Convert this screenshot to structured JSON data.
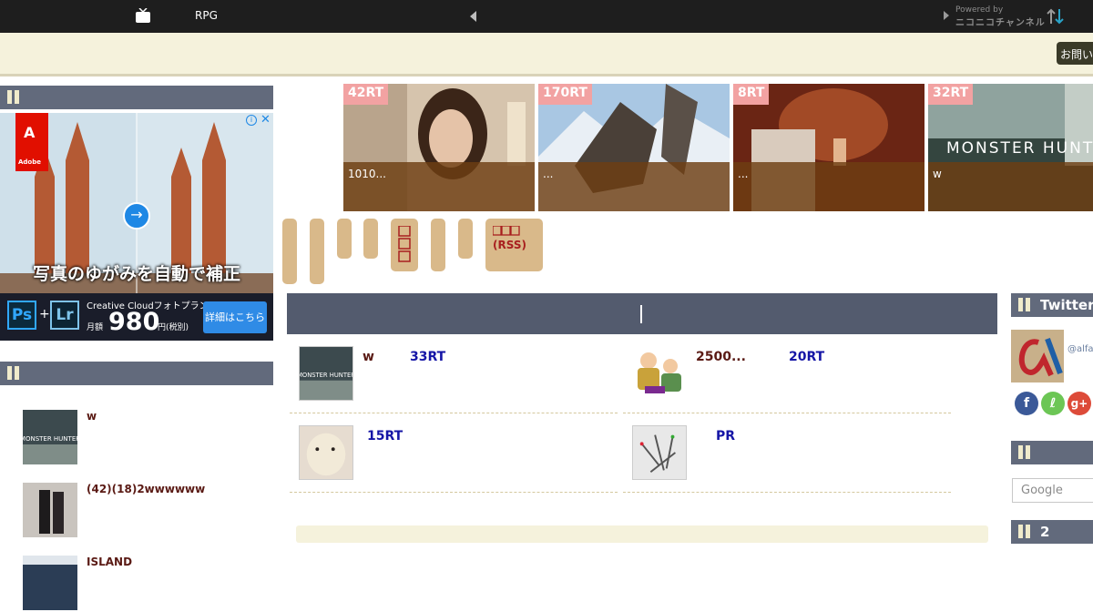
{
  "topbar": {
    "title": "RPG",
    "powered_by": "Powered by",
    "niconico": "ニコニコチャンネル"
  },
  "header": {
    "contact_label": "お問い"
  },
  "left_sidebar": {
    "ad": {
      "brand": "Adobe",
      "headline": "写真のゆがみを自動で補正",
      "ps": "Ps",
      "lr": "Lr",
      "plus": "+",
      "plan": "Creative Cloudフォトプラン",
      "price_label": "月額",
      "price": "980",
      "price_unit": "円(税別)",
      "cta": "詳細はこちら"
    },
    "items": [
      {
        "title": "w"
      },
      {
        "title": "(42)(18)2wwwwww"
      },
      {
        "title": "ISLAND"
      }
    ]
  },
  "featured": [
    {
      "rt": "42RT",
      "caption": "1010..."
    },
    {
      "rt": "170RT",
      "caption": "..."
    },
    {
      "rt": "8RT",
      "caption": "..."
    },
    {
      "rt": "32RT",
      "caption": "w",
      "overlay": "MONSTER HUNTER"
    }
  ],
  "categories": {
    "tab_a": "",
    "tab_b": "",
    "tab_c": "",
    "tab_d": "",
    "tab_e": "",
    "tab_f": "",
    "tab_g": "",
    "tab_rss": "(RSS)"
  },
  "articles": [
    {
      "title": "w",
      "rt": "33RT"
    },
    {
      "title": "2500...",
      "rt": "20RT"
    },
    {
      "title": "",
      "rt": "15RT"
    },
    {
      "title": "",
      "rt": "PR"
    }
  ],
  "right_sidebar": {
    "twitter_title": "Twitter",
    "handle": "@alfa",
    "google_placeholder": "Google",
    "section_2_title": "2"
  },
  "colors": {
    "topbar_bg": "#1e1e1e",
    "section_header": "#626a7c",
    "cream": "#f5f2dc",
    "rt_badge": "#f2a2a2",
    "article_title": "#5a1a14",
    "rt_text": "#1515a6"
  }
}
